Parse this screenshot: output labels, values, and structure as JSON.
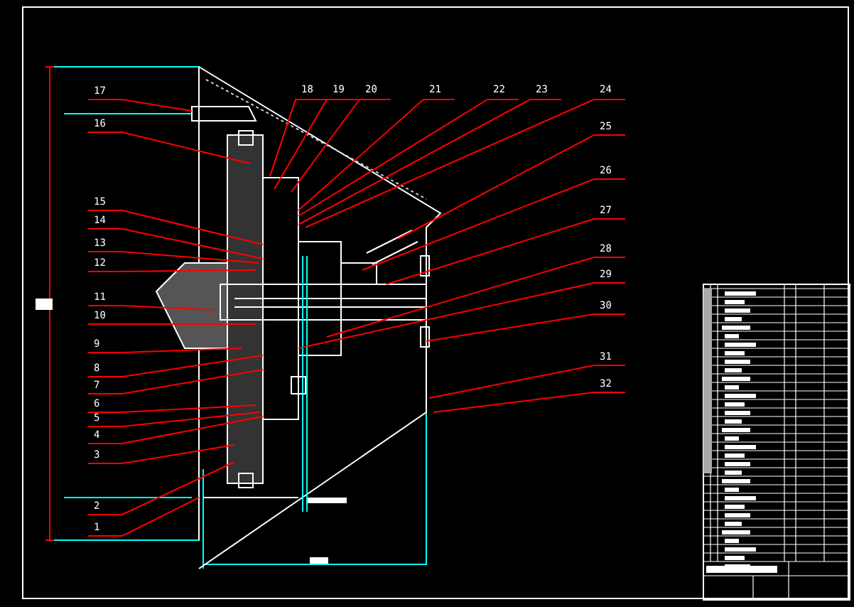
{
  "left_callouts": [
    {
      "label": "17"
    },
    {
      "label": "16"
    },
    {
      "label": "15"
    },
    {
      "label": "14"
    },
    {
      "label": "13"
    },
    {
      "label": "12"
    },
    {
      "label": "11"
    },
    {
      "label": "10"
    },
    {
      "label": "9"
    },
    {
      "label": "8"
    },
    {
      "label": "7"
    },
    {
      "label": "6"
    },
    {
      "label": "5"
    },
    {
      "label": "4"
    },
    {
      "label": "3"
    },
    {
      "label": "2"
    },
    {
      "label": "1"
    }
  ],
  "top_callouts": [
    {
      "label": "18"
    },
    {
      "label": "19"
    },
    {
      "label": "20"
    },
    {
      "label": "21"
    },
    {
      "label": "22"
    },
    {
      "label": "23"
    },
    {
      "label": "24"
    }
  ],
  "right_callouts": [
    {
      "label": "25"
    },
    {
      "label": "26"
    },
    {
      "label": "27"
    },
    {
      "label": "28"
    },
    {
      "label": "29"
    },
    {
      "label": "30"
    },
    {
      "label": "31"
    },
    {
      "label": "32"
    }
  ]
}
